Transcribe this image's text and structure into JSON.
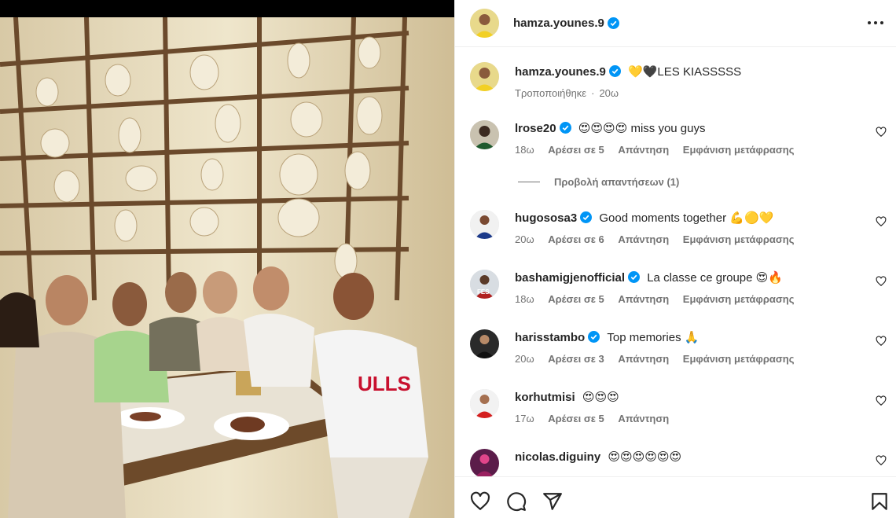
{
  "post": {
    "author": "hamza.younes.9",
    "more_icon": "more-horizontal-icon"
  },
  "caption": {
    "author": "hamza.younes.9",
    "emojis": "💛🖤",
    "text": "LES KIASSSSS",
    "edited": "Τροποποιήθηκε",
    "time": "20ω"
  },
  "comments": [
    {
      "user": "lrose20",
      "verified": true,
      "emojis": "😍😍😍😍",
      "text": "miss you guys",
      "time": "18ω",
      "likes": "Αρέσει σε 5",
      "reply": "Απάντηση",
      "translate": "Εμφάνιση μετάφρασης"
    },
    {
      "user": "hugososa3",
      "verified": true,
      "emojis": "",
      "text": "Good moments together",
      "trail": "💪🟡💛",
      "time": "20ω",
      "likes": "Αρέσει σε 6",
      "reply": "Απάντηση",
      "translate": "Εμφάνιση μετάφρασης"
    },
    {
      "user": "bashamigjenofficial",
      "verified": true,
      "emojis": "",
      "text": "La classe ce groupe",
      "trail": "😍🔥",
      "time": "18ω",
      "likes": "Αρέσει σε 5",
      "reply": "Απάντηση",
      "translate": "Εμφάνιση μετάφρασης"
    },
    {
      "user": "harisstambo",
      "verified": true,
      "emojis": "",
      "text": "Top memories",
      "trail": "🙏",
      "time": "20ω",
      "likes": "Αρέσει σε 3",
      "reply": "Απάντηση",
      "translate": "Εμφάνιση μετάφρασης"
    },
    {
      "user": "korhutmisi",
      "verified": false,
      "emojis": "😍😍😍",
      "text": "",
      "time": "17ω",
      "likes": "Αρέσει σε 5",
      "reply": "Απάντηση"
    },
    {
      "user": "nicolas.diguiny",
      "verified": false,
      "emojis": "😍😍😍😍😍😍",
      "text": ""
    }
  ],
  "view_replies": "Προβολή απαντήσεων (1)",
  "actions": {
    "like_icon": "heart-icon",
    "comment_icon": "comment-icon",
    "share_icon": "share-icon",
    "save_icon": "bookmark-icon"
  },
  "colors": {
    "verified": "#0095f6",
    "secondary_text": "#737373",
    "primary_text": "#262626"
  }
}
